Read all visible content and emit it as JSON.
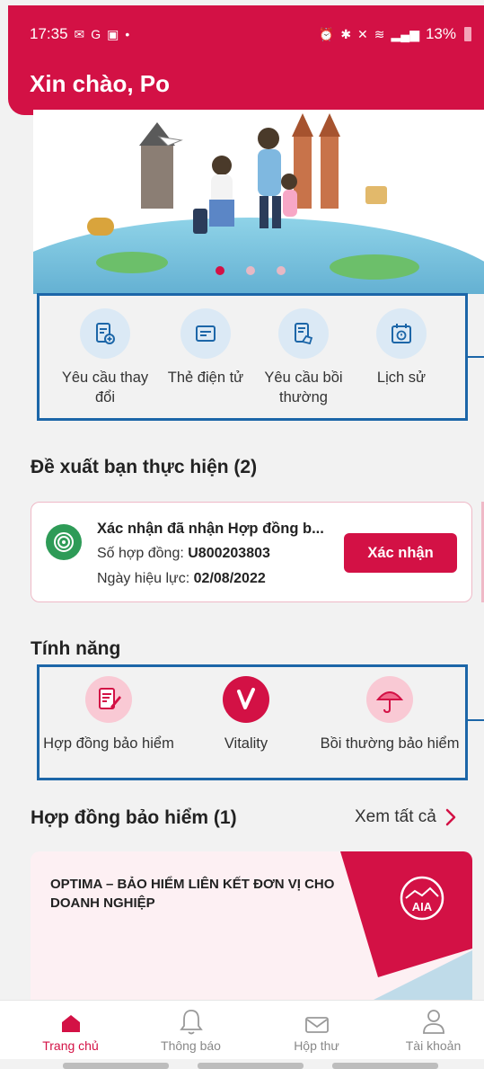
{
  "status_bar": {
    "time": "17:35",
    "battery": "13%"
  },
  "header": {
    "greeting": "Xin chào, Po"
  },
  "banner": {
    "slides": 3,
    "active_slide": 1
  },
  "quick_actions": [
    {
      "label": "Yêu cầu thay đổi",
      "icon": "document-add-icon"
    },
    {
      "label": "Thẻ điện tử",
      "icon": "card-icon"
    },
    {
      "label": "Yêu cầu bồi thường",
      "icon": "claim-document-icon"
    },
    {
      "label": "Lịch sử",
      "icon": "calendar-history-icon"
    }
  ],
  "suggestions": {
    "title": "Đề xuất bạn thực hiện (2)",
    "card": {
      "title": "Xác nhận đã nhận Hợp đồng b...",
      "contract_label": "Số hợp đồng:",
      "contract_value": "U800203803",
      "date_label": "Ngày hiệu lực:",
      "date_value": "02/08/2022",
      "button": "Xác nhận"
    }
  },
  "features": {
    "title": "Tính năng",
    "items": [
      {
        "label": "Hợp đồng bảo hiểm",
        "icon": "contract-pen-icon"
      },
      {
        "label": "Vitality",
        "icon": "vitality-logo-icon"
      },
      {
        "label": "Bồi thường bảo hiểm",
        "icon": "umbrella-icon"
      }
    ]
  },
  "policies": {
    "title": "Hợp đồng bảo hiểm (1)",
    "see_all": "Xem tất cả",
    "card_name": "OPTIMA – BẢO HIỂM LIÊN KẾT ĐƠN VỊ CHO DOANH NGHIỆP",
    "brand": "AIA"
  },
  "bottom_nav": [
    {
      "label": "Trang chủ",
      "icon": "home-icon",
      "active": true
    },
    {
      "label": "Thông báo",
      "icon": "bell-icon",
      "active": false
    },
    {
      "label": "Hộp thư",
      "icon": "mail-icon",
      "active": false
    },
    {
      "label": "Tài khoản",
      "icon": "user-icon",
      "active": false
    }
  ],
  "colors": {
    "brand": "#d31145",
    "highlight": "#1c66a8",
    "icon_bg": "#dbe9f5"
  }
}
